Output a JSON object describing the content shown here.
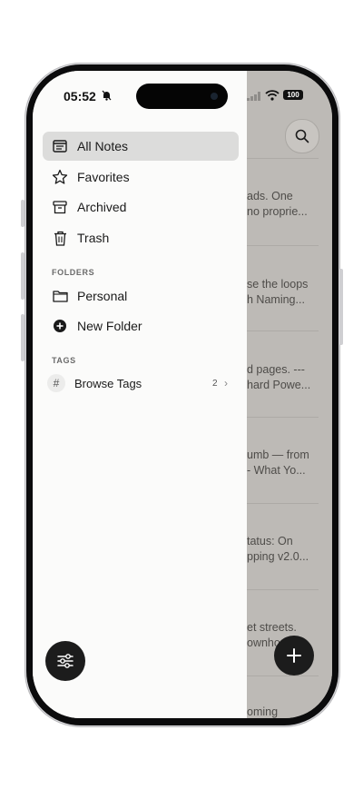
{
  "status_bar": {
    "time": "05:52",
    "battery": "100"
  },
  "sidebar": {
    "items": [
      {
        "label": "All Notes",
        "icon": "notes-icon",
        "active": true
      },
      {
        "label": "Favorites",
        "icon": "star-icon"
      },
      {
        "label": "Archived",
        "icon": "archive-icon"
      },
      {
        "label": "Trash",
        "icon": "trash-icon"
      }
    ],
    "folders_heading": "FOLDERS",
    "folders": [
      {
        "label": "Personal",
        "icon": "folder-icon"
      },
      {
        "label": "New Folder",
        "icon": "plus-circle-icon"
      }
    ],
    "tags_heading": "TAGS",
    "tags": {
      "label": "Browse Tags",
      "count": "2"
    }
  },
  "notes_preview": [
    {
      "line1": "ads. One",
      "line2": "no proprie..."
    },
    {
      "line1": "se the loops",
      "line2": "h Naming..."
    },
    {
      "line1": "d pages.  ---",
      "line2": "hard Powe..."
    },
    {
      "line1": "umb — from",
      "line2": "-  What Yo..."
    },
    {
      "line1": "tatus: On",
      "line2": "pping v2.0..."
    },
    {
      "line1": "et streets.",
      "line2": "ownho..."
    },
    {
      "line1": "oming",
      "line2": ""
    }
  ],
  "colors": {
    "accent": "#1c1c1c",
    "active_bg": "#dcdcdb",
    "overlay": "#bdbab6"
  }
}
